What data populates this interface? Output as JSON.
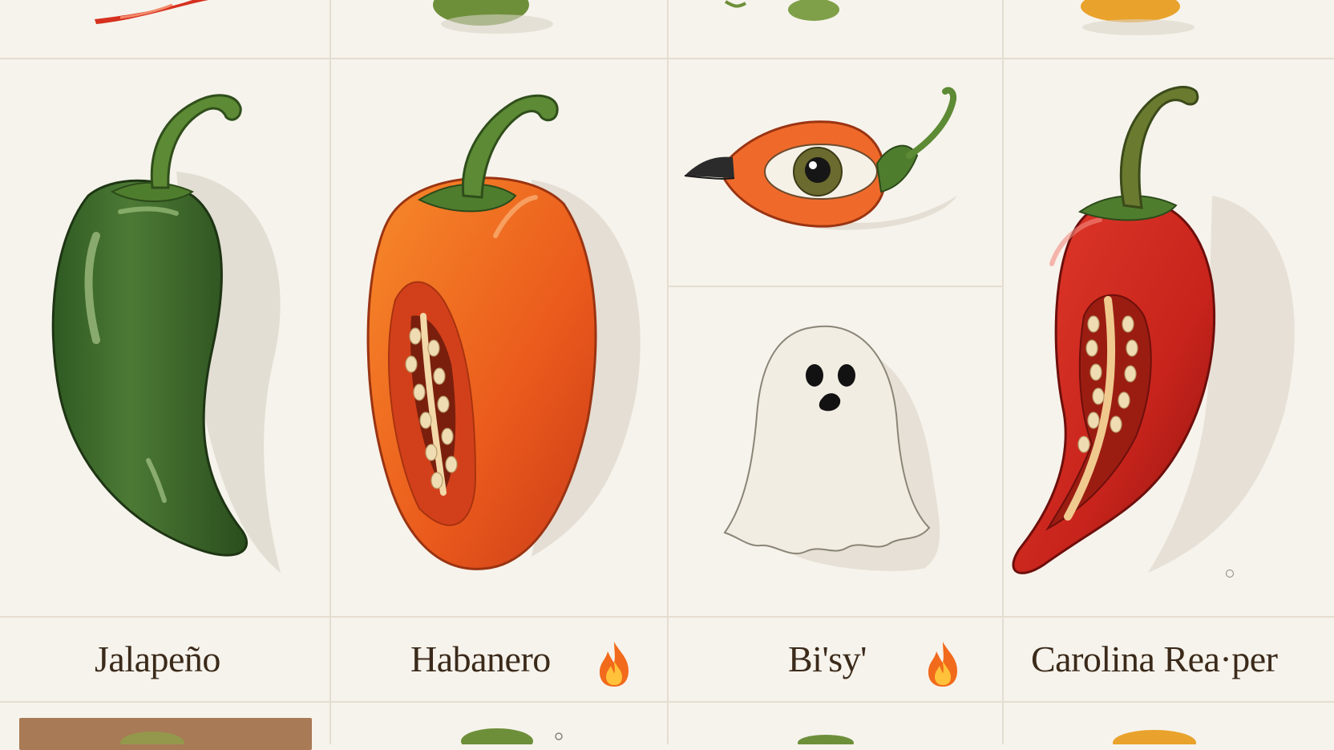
{
  "grid": {
    "columns": [
      {
        "id": "jalapeno",
        "label": "Jalapeño",
        "has_flame": false
      },
      {
        "id": "habanero",
        "label": "Habanero",
        "has_flame": true
      },
      {
        "id": "bisy",
        "label": "Bi'sy'",
        "has_flame": true
      },
      {
        "id": "carolina",
        "label": "Carolina Rea·per",
        "has_flame": false
      }
    ]
  },
  "icons": {
    "flame": "flame-icon",
    "ghost": "ghost-icon",
    "eye_pepper": "eye-pepper-icon"
  },
  "colors": {
    "background": "#f6f3ec",
    "grid_line": "#e4ddd0",
    "label_text": "#3b2a1a",
    "jalapeno_green": "#3f6a2c",
    "habanero_orange": "#f0641c",
    "reaper_red": "#c8241c",
    "ghost_white": "#f1ede2",
    "flame_orange": "#f26a1b",
    "flame_yellow": "#ffc23a",
    "card_brown": "#a87a56"
  }
}
